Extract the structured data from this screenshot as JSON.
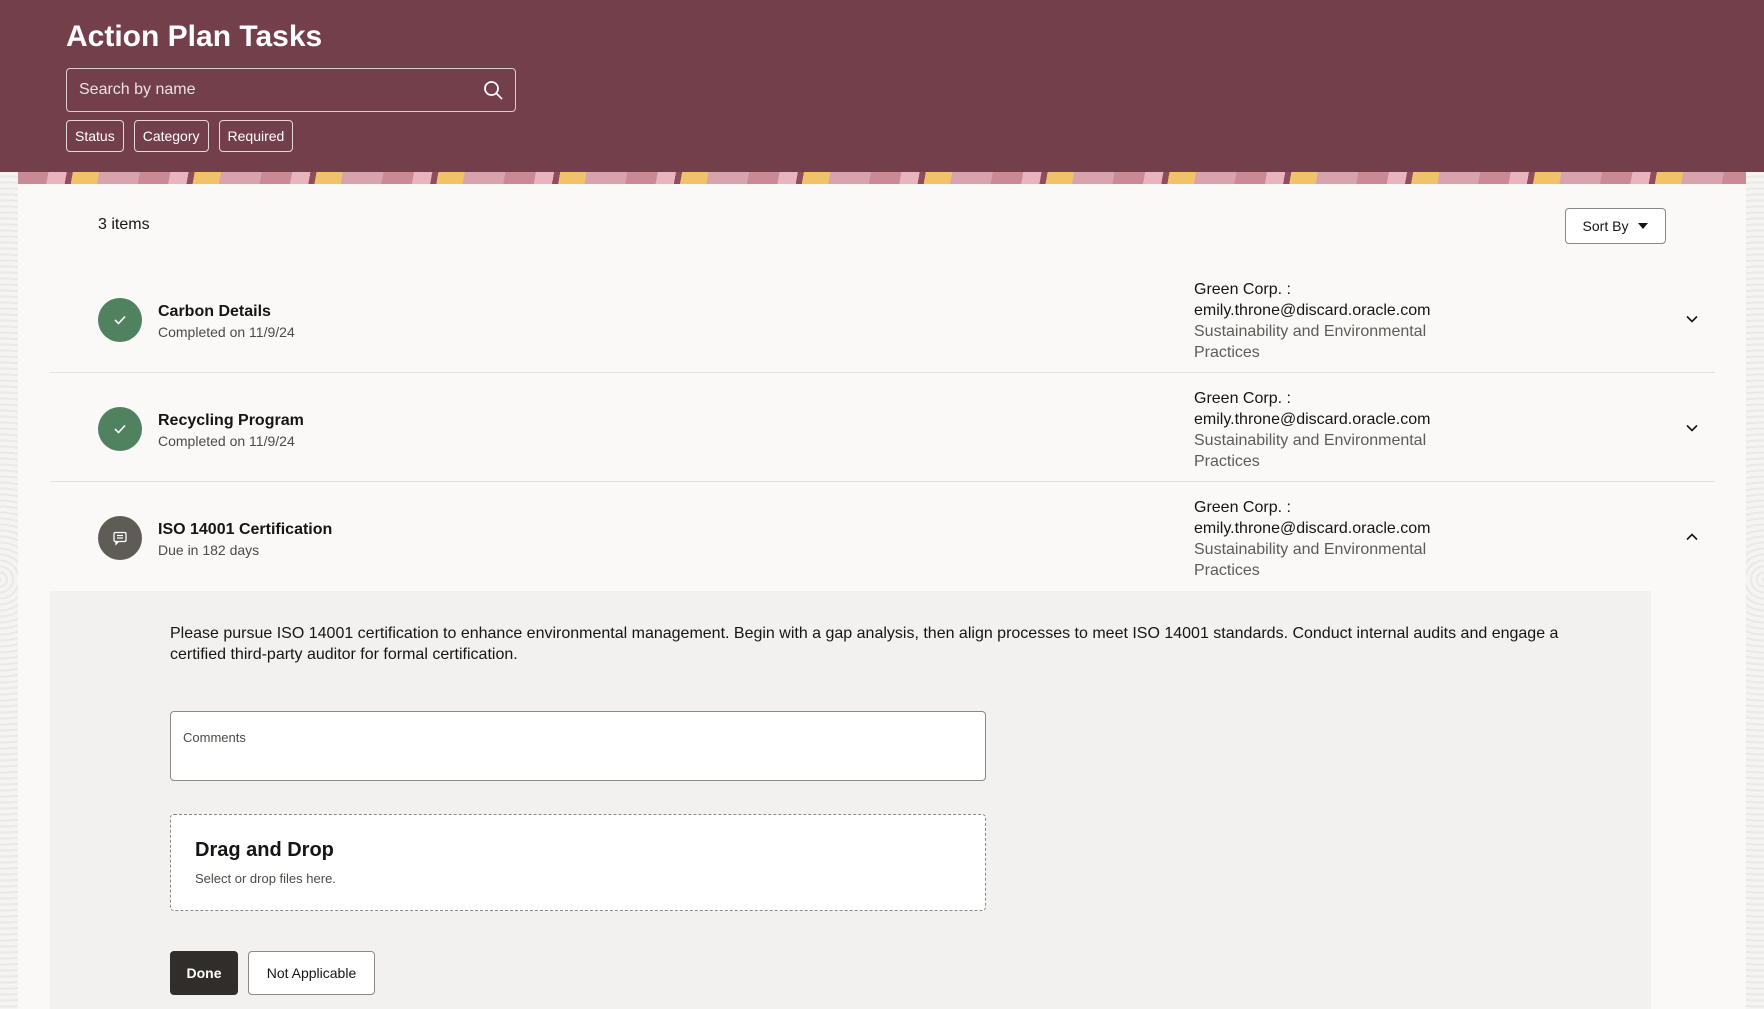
{
  "header": {
    "title": "Action Plan Tasks",
    "search_placeholder": "Search by name",
    "filters": [
      "Status",
      "Category",
      "Required"
    ]
  },
  "list": {
    "count_label": "3 items",
    "sort_label": "Sort By"
  },
  "tasks": [
    {
      "title": "Carbon Details",
      "subtitle": "Completed on 11/9/24",
      "status": "completed",
      "org": "Green Corp. :",
      "email": "emily.throne@discard.oracle.com",
      "category": "Sustainability and Environmental Practices",
      "expanded": false
    },
    {
      "title": "Recycling Program",
      "subtitle": "Completed on 11/9/24",
      "status": "completed",
      "org": "Green Corp. :",
      "email": "emily.throne@discard.oracle.com",
      "category": "Sustainability and Environmental Practices",
      "expanded": false
    },
    {
      "title": "ISO 14001 Certification",
      "subtitle": "Due in 182 days",
      "status": "pending",
      "org": "Green Corp. :",
      "email": "emily.throne@discard.oracle.com",
      "category": "Sustainability and Environmental Practices",
      "expanded": true
    }
  ],
  "detail": {
    "description": "Please pursue ISO 14001 certification to enhance environmental management. Begin with a gap analysis, then align processes to meet ISO 14001 standards. Conduct internal audits and engage a certified third-party auditor for formal certification.",
    "comments_label": "Comments",
    "comments_value": "",
    "dropzone_title": "Drag and Drop",
    "dropzone_subtitle": "Select or drop files here.",
    "done_label": "Done",
    "not_applicable_label": "Not Applicable"
  },
  "colors": {
    "header_bg": "#723f4b",
    "completed": "#508260",
    "pending": "#5f5b57"
  }
}
